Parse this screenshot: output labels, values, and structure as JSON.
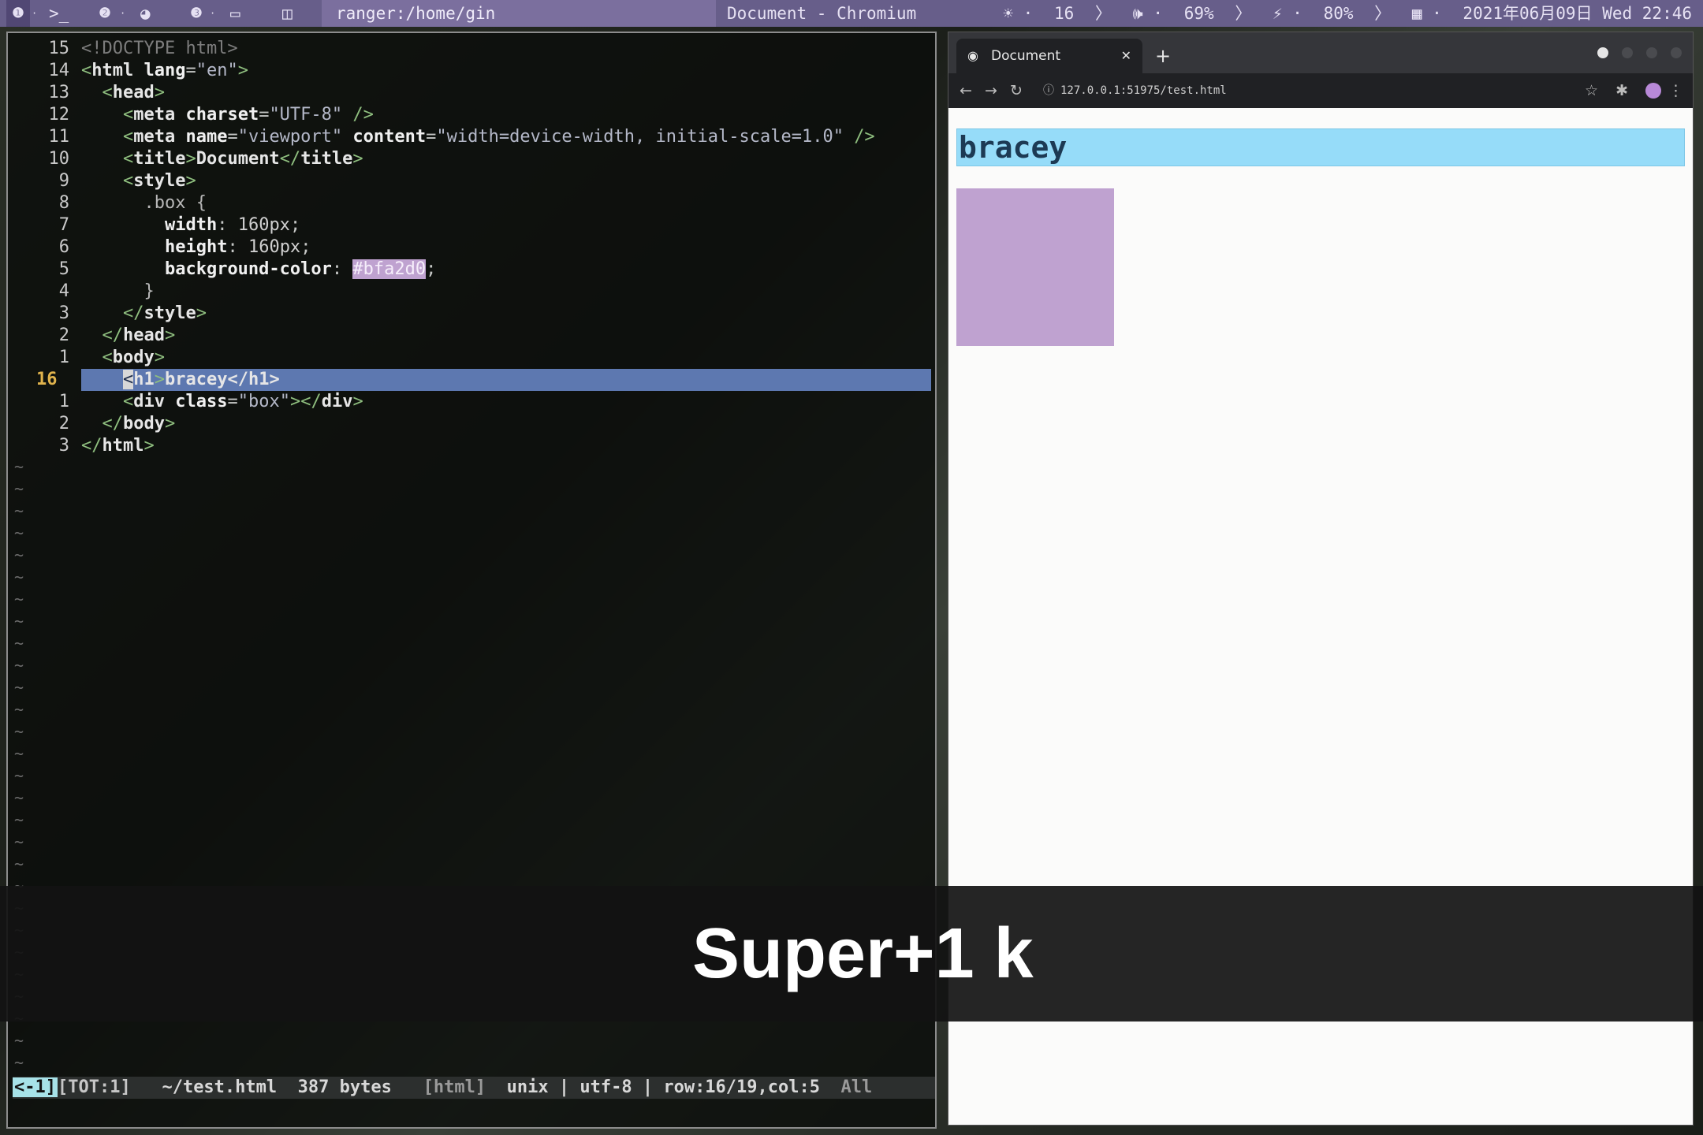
{
  "topbar": {
    "workspaces": [
      "1",
      ">_",
      "2",
      "chromium",
      "3",
      "monitor",
      "layout"
    ],
    "ranger_title": "ranger:/home/gin",
    "window_title": "Document - Chromium",
    "brightness": "16",
    "volume": "69%",
    "battery": "80%",
    "datetime": "2021年06月09日 Wed 22:46"
  },
  "editor": {
    "lines": [
      {
        "num": "15",
        "html": "<span class='cmt'>&lt;!DOCTYPE html&gt;</span>"
      },
      {
        "num": "14",
        "html": "<span class='punc'>&lt;</span><span class='tag'>html</span> <span class='attr'>lang</span>=<span class='str'>\"en\"</span><span class='punc'>&gt;</span>"
      },
      {
        "num": "13",
        "html": "  <span class='punc'>&lt;</span><span class='tag'>head</span><span class='punc'>&gt;</span>"
      },
      {
        "num": "12",
        "html": "    <span class='punc'>&lt;</span><span class='tag'>meta</span> <span class='attr'>charset</span>=<span class='str'>\"UTF-8\"</span> <span class='punc'>/&gt;</span>"
      },
      {
        "num": "11",
        "html": "    <span class='punc'>&lt;</span><span class='tag'>meta</span> <span class='attr'>name</span>=<span class='str'>\"viewport\"</span> <span class='attr'>content</span>=<span class='str'>\"width=device-width, initial-scale=1.0\"</span> <span class='punc'>/&gt;</span>"
      },
      {
        "num": "10",
        "html": "    <span class='punc'>&lt;</span><span class='tag'>title</span><span class='punc'>&gt;</span><span class='tag'>Document</span><span class='punc'>&lt;/</span><span class='tag'>title</span><span class='punc'>&gt;</span>"
      },
      {
        "num": "9",
        "html": "    <span class='punc'>&lt;</span><span class='tag'>style</span><span class='punc'>&gt;</span>"
      },
      {
        "num": "8",
        "html": "      <span class='sel'>.box {</span>"
      },
      {
        "num": "7",
        "html": "        <span class='prop'>width</span>: <span class='val'>160px</span>;"
      },
      {
        "num": "6",
        "html": "        <span class='prop'>height</span>: <span class='val'>160px</span>;"
      },
      {
        "num": "5",
        "html": "        <span class='prop'>background-color</span>: <span class='colorbg'>#bfa2d0</span>;"
      },
      {
        "num": "4",
        "html": "      <span class='sel'>}</span>"
      },
      {
        "num": "3",
        "html": "    <span class='punc'>&lt;/</span><span class='tag'>style</span><span class='punc'>&gt;</span>"
      },
      {
        "num": "2",
        "html": "  <span class='punc'>&lt;/</span><span class='tag'>head</span><span class='punc'>&gt;</span>"
      },
      {
        "num": "1",
        "html": "  <span class='punc'>&lt;</span><span class='tag'>body</span><span class='punc'>&gt;</span>"
      },
      {
        "num": "16",
        "current": true,
        "html": "    <span class='curs'>&lt;</span><span class='tag'>h1</span><span class='punc'>&gt;</span><span class='tag'>bracey</span><span class='tag'>&lt;/h1&gt;</span>"
      },
      {
        "num": "1",
        "html": "    <span class='punc'>&lt;</span><span class='tag'>div</span> <span class='attr'>class</span>=<span class='str'>\"box\"</span><span class='punc'>&gt;&lt;/</span><span class='tag'>div</span><span class='punc'>&gt;</span>"
      },
      {
        "num": "2",
        "html": "  <span class='punc'>&lt;/</span><span class='tag'>body</span><span class='punc'>&gt;</span>"
      },
      {
        "num": "3",
        "html": "<span class='punc'>&lt;/</span><span class='tag'>html</span><span class='punc'>&gt;</span>"
      }
    ],
    "status": {
      "mode": "<-1]",
      "tot": "[TOT:1]",
      "file": "~/test.html",
      "size": "387 bytes",
      "filetype": "[html]",
      "format": "unix",
      "encoding": "utf-8",
      "position": "row:16/19,col:5",
      "scroll": "All"
    }
  },
  "browser": {
    "tab_title": "Document",
    "url": "127.0.0.1:51975/test.html",
    "h1_text": "bracey",
    "box_color": "#bfa2d0"
  },
  "overlay": {
    "keys": "Super+1 k"
  }
}
